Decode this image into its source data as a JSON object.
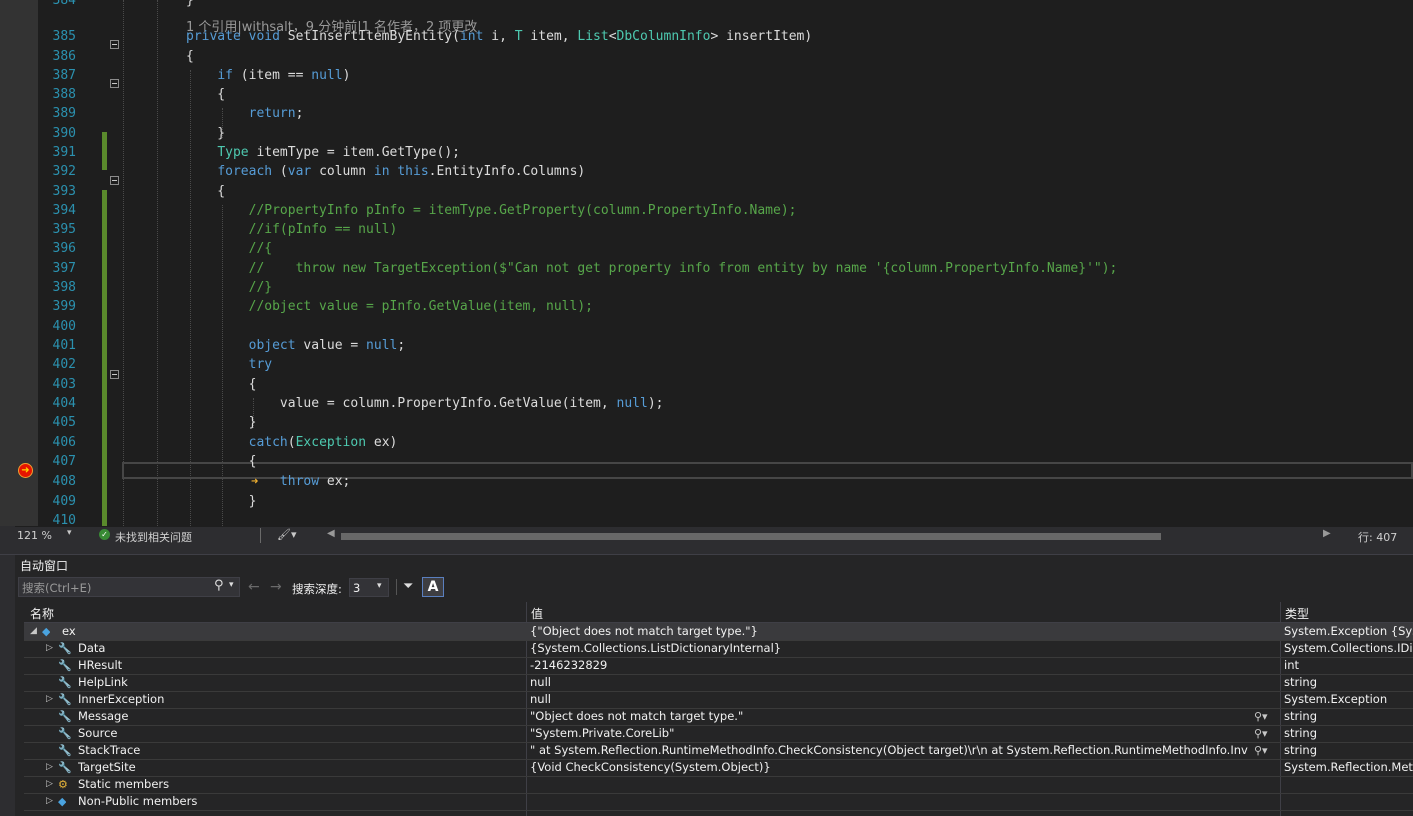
{
  "codelens": "1 个引用|withsalt，9 分钟前|1 名作者，2 项更改",
  "code_lines": [
    {
      "num": "384",
      "text": "}"
    },
    {
      "num": "385",
      "text": "private void SetInsertItemByEntity(int i, T item, List<DbColumnInfo> insertItem)"
    },
    {
      "num": "386",
      "text": "{"
    },
    {
      "num": "387",
      "text": "    if (item == null)"
    },
    {
      "num": "388",
      "text": "    {"
    },
    {
      "num": "389",
      "text": "        return;"
    },
    {
      "num": "390",
      "text": "    }"
    },
    {
      "num": "391",
      "text": "    Type itemType = item.GetType();"
    },
    {
      "num": "392",
      "text": "    foreach (var column in this.EntityInfo.Columns)"
    },
    {
      "num": "393",
      "text": "    {"
    },
    {
      "num": "394",
      "text": "        //PropertyInfo pInfo = itemType.GetProperty(column.PropertyInfo.Name);"
    },
    {
      "num": "395",
      "text": "        //if(pInfo == null)"
    },
    {
      "num": "396",
      "text": "        //{"
    },
    {
      "num": "397",
      "text": "        //    throw new TargetException($\"Can not get property info from entity by name '{column.PropertyInfo.Name}'\");"
    },
    {
      "num": "398",
      "text": "        //}"
    },
    {
      "num": "399",
      "text": "        //object value = pInfo.GetValue(item, null);"
    },
    {
      "num": "400",
      "text": ""
    },
    {
      "num": "401",
      "text": "        object value = null;"
    },
    {
      "num": "402",
      "text": "        try"
    },
    {
      "num": "403",
      "text": "        {"
    },
    {
      "num": "404",
      "text": "            value = column.PropertyInfo.GetValue(item, null);"
    },
    {
      "num": "405",
      "text": "        }"
    },
    {
      "num": "406",
      "text": "        catch(Exception ex)"
    },
    {
      "num": "407",
      "text": "        {"
    },
    {
      "num": "408",
      "text": "            throw ex;"
    },
    {
      "num": "409",
      "text": "        }"
    },
    {
      "num": "410",
      "text": ""
    }
  ],
  "status": {
    "zoom": "121 %",
    "issues": "未找到相关问题",
    "line": "行: 407"
  },
  "autos": {
    "title": "自动窗口",
    "search_placeholder": "搜索(Ctrl+E)",
    "depth_label": "搜索深度:",
    "depth_value": "3",
    "col_name": "名称",
    "col_value": "值",
    "col_type": "类型",
    "rows": [
      {
        "name": "ex",
        "value": "{\"Object does not match target type.\"}",
        "type": "System.Exception {System.Reflection.TargetException}",
        "expand": "open",
        "icon": "cube"
      },
      {
        "name": "Data",
        "value": "{System.Collections.ListDictionaryInternal}",
        "type": "System.Collections.IDictionary",
        "expand": "closed",
        "icon": "wrench"
      },
      {
        "name": "HResult",
        "value": "-2146232829",
        "type": "int",
        "expand": "none",
        "icon": "wrench"
      },
      {
        "name": "HelpLink",
        "value": "null",
        "type": "string",
        "expand": "none",
        "icon": "wrench"
      },
      {
        "name": "InnerException",
        "value": "null",
        "type": "System.Exception",
        "expand": "closed",
        "icon": "wrench"
      },
      {
        "name": "Message",
        "value": "\"Object does not match target type.\"",
        "type": "string",
        "expand": "none",
        "icon": "wrench",
        "viewer": true
      },
      {
        "name": "Source",
        "value": "\"System.Private.CoreLib\"",
        "type": "string",
        "expand": "none",
        "icon": "wrench",
        "viewer": true
      },
      {
        "name": "StackTrace",
        "value": "\"   at System.Reflection.RuntimeMethodInfo.CheckConsistency(Object target)\\r\\n   at System.Reflection.RuntimeMethodInfo.InvokeAr...",
        "type": "string",
        "expand": "none",
        "icon": "wrench",
        "viewer": true
      },
      {
        "name": "TargetSite",
        "value": "{Void CheckConsistency(System.Object)}",
        "type": "System.Reflection.MethodBase",
        "expand": "closed",
        "icon": "wrench"
      },
      {
        "name": "Static members",
        "value": "",
        "type": "",
        "expand": "closed",
        "icon": "static"
      },
      {
        "name": "Non-Public members",
        "value": "",
        "type": "",
        "expand": "closed",
        "icon": "cube"
      }
    ]
  }
}
